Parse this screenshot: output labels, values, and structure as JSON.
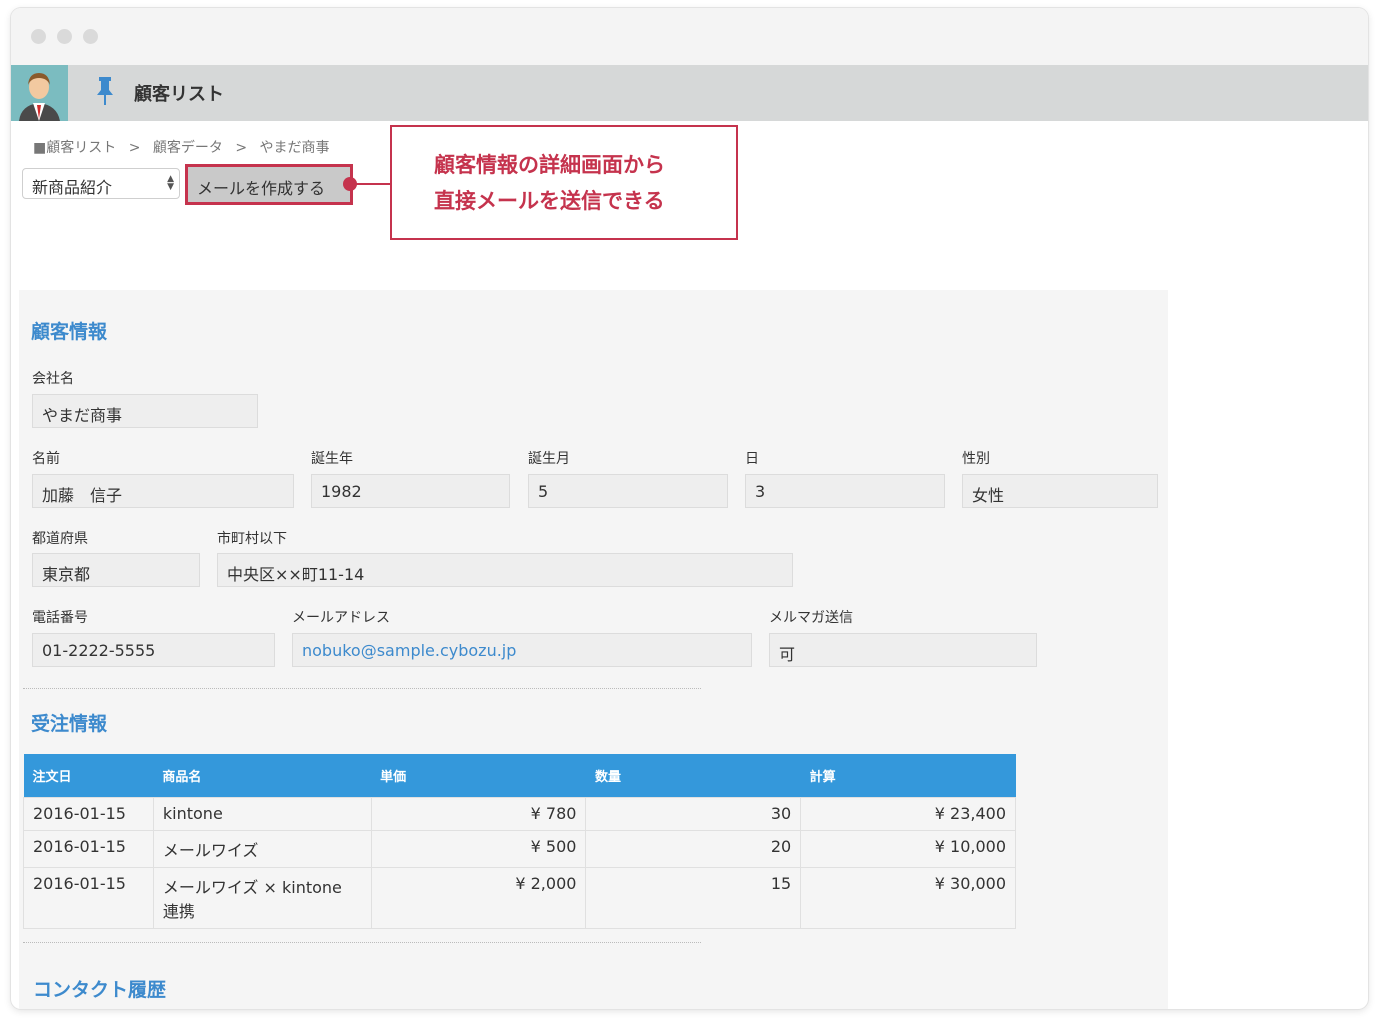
{
  "app": {
    "title": "顧客リスト"
  },
  "breadcrumb": [
    "■顧客リスト",
    ">",
    "顧客データ",
    ">",
    "やまだ商事"
  ],
  "toolbar": {
    "template_value": "新商品紹介",
    "compose_label": "メールを作成する"
  },
  "callout": {
    "line1": "顧客情報の詳細画面から",
    "line2": "直接メールを送信できる"
  },
  "customer": {
    "section_title": "顧客情報",
    "company_label": "会社名",
    "company": "やまだ商事",
    "name_label": "名前",
    "name": "加藤　信子",
    "birth_year_label": "誕生年",
    "birth_year": "1982",
    "birth_month_label": "誕生月",
    "birth_month": "5",
    "birth_day_label": "日",
    "birth_day": "3",
    "gender_label": "性別",
    "gender": "女性",
    "prefecture_label": "都道府県",
    "prefecture": "東京都",
    "city_label": "市町村以下",
    "city": "中央区××町11-14",
    "phone_label": "電話番号",
    "phone": "01-2222-5555",
    "email_label": "メールアドレス",
    "email": "nobuko@sample.cybozu.jp",
    "newsletter_label": "メルマガ送信",
    "newsletter": "可"
  },
  "orders": {
    "section_title": "受注情報",
    "headers": [
      "注文日",
      "商品名",
      "単価",
      "数量",
      "計算"
    ],
    "rows": [
      [
        "2016-01-15",
        "kintone",
        "¥ 780",
        "30",
        "¥ 23,400"
      ],
      [
        "2016-01-15",
        "メールワイズ",
        "¥ 500",
        "20",
        "¥ 10,000"
      ],
      [
        "2016-01-15",
        "メールワイズ × kintone 連携",
        "¥ 2,000",
        "15",
        "¥ 30,000"
      ]
    ]
  },
  "contact": {
    "section_title": "コンタクト履歴"
  },
  "colors": {
    "accent": "#c5334d",
    "header_blue": "#3498db",
    "section_blue": "#3d8acd"
  }
}
